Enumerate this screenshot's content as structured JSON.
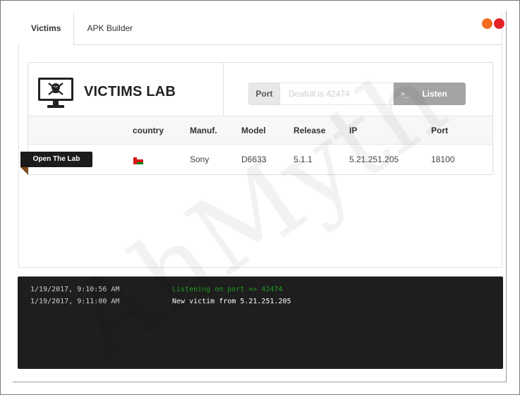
{
  "tabs": [
    {
      "label": "Victims",
      "active": true
    },
    {
      "label": "APK Builder",
      "active": false
    }
  ],
  "window_controls": {
    "minimize_color": "#f26b21",
    "close_color": "#e32126"
  },
  "lab": {
    "title": "VICTIMS LAB",
    "icon": "monitor-skull-icon",
    "port_label": "Port",
    "port_placeholder": "Deafult is 42474",
    "port_value": "",
    "listen_label": "Listen",
    "listen_icon": ">_"
  },
  "table": {
    "columns": [
      "country",
      "Manuf.",
      "Model",
      "Release",
      "IP",
      "Port"
    ],
    "rows": [
      {
        "action": "Open The Lab",
        "country_flag": "oman-flag-icon",
        "manuf": "Sony",
        "model": "D6633",
        "release": "5.1.1",
        "ip": "5.21.251.205",
        "port": "18100"
      }
    ]
  },
  "console": {
    "lines": [
      {
        "time": "1/19/2017, 9:10:56 AM",
        "message": "Listening on port => 42474",
        "color": "#1e9e1e"
      },
      {
        "time": "1/19/2017, 9:11:00 AM",
        "message": "New victim from 5.21.251.205",
        "color": "#ffffff"
      }
    ]
  },
  "watermark": "AhMyth"
}
